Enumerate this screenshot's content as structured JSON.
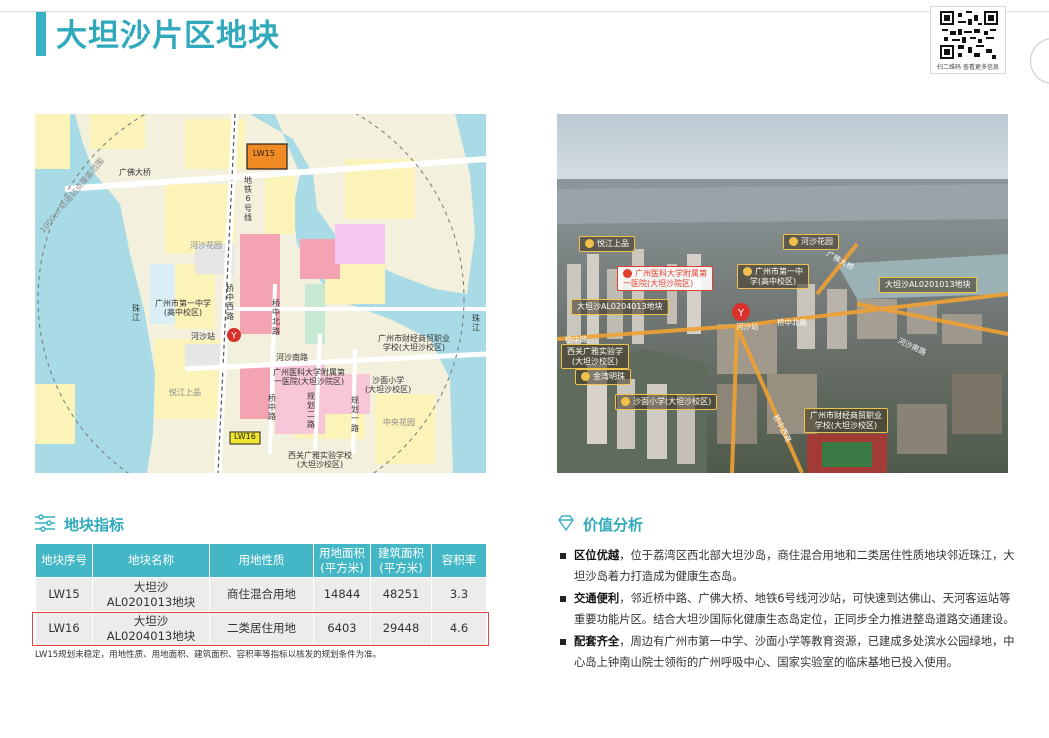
{
  "page": {
    "title": "大坦沙片区地块",
    "qr_caption": "扫二维码 查看更多信息"
  },
  "map": {
    "labels": {
      "radius": "1000m 轨道站点覆盖范围",
      "guangfo_bridge": "广佛大桥",
      "lw15": "LW15",
      "lw16": "LW16",
      "metro_line": "地铁6号线",
      "hesha_garden": "河沙花园",
      "no1_middle": "广州市第一中学\n(高中校区)",
      "pearl_left": "珠江",
      "pearl_right": "珠江",
      "hesha_station": "河沙站",
      "qiaozhongxi": "桥中西路",
      "qiaozhongbei": "桥中北路",
      "finance_school": "广州市财经商贸职业\n学校(大坦沙校区)",
      "hesha_south": "河沙南路",
      "hospital": "广州医科大学附属第\n一医院(大坦沙院区)",
      "shamian_primary": "沙面小学\n(大坦沙校区)",
      "yuejiang": "悦江上品",
      "qiaozhong": "桥中路",
      "guihua2": "规划二路",
      "guihua1": "规划一路",
      "central_park": "中央花园",
      "xiguan_school": "西关广雅实验学校\n(大坦沙校区)"
    }
  },
  "photo": {
    "labels": {
      "yuejiang": "悦江上品",
      "hesha_garden": "河沙花园",
      "hospital": "广州医科大学附属第\n一医院(大坦沙院区)",
      "no1_middle": "广州市第一中\n学(高中校区)",
      "guangfo_bridge": "广佛大桥",
      "lw15": "大坦沙AL0201013地块",
      "lw16": "大坦沙AL0204013地块",
      "hesha_station": "河沙站",
      "qiaozhong": "桥中路",
      "qiaozhongbei": "桥中北路",
      "xiguan_school": "西关广雅实验学\n(大坦沙校区)",
      "jinwan": "金湾明珠",
      "hesha_south": "河沙南路",
      "shamian_primary": "沙面小学(大坦沙校区)",
      "finance_school": "广州市财经商贸职业\n学校(大坦沙校区)",
      "qiaozhongxi": "桥中西路"
    }
  },
  "indicators": {
    "heading": "地块指标",
    "columns": [
      "地块序号",
      "地块名称",
      "用地性质",
      "用地面积\n(平方米)",
      "建筑面积\n(平方米)",
      "容积率"
    ],
    "rows": [
      [
        "LW15",
        "大坦沙\nAL0201013地块",
        "商住混合用地",
        "14844",
        "48251",
        "3.3"
      ],
      [
        "LW16",
        "大坦沙\nAL0204013地块",
        "二类居住用地",
        "6403",
        "29448",
        "4.6"
      ]
    ],
    "footnote": "LW15规划未稳定，用地性质、用地面积、建筑面积、容积率等指标以核发的规划条件为准。"
  },
  "value_analysis": {
    "heading": "价值分析",
    "items": [
      {
        "title": "区位优越",
        "text": "，位于荔湾区西北部大坦沙岛，商住混合用地和二类居住性质地块邻近珠江，大坦沙岛着力打造成为健康生态岛。"
      },
      {
        "title": "交通便利",
        "text": "，邻近桥中路、广佛大桥、地铁6号线河沙站，可快速到达佛山、天河客运站等重要功能片区。结合大坦沙国际化健康生态岛定位，正同步全力推进整岛道路交通建设。"
      },
      {
        "title": "配套齐全",
        "text": "，周边有广州市第一中学、沙面小学等教育资源，已建成多处滨水公园绿地，中心岛上钟南山院士领衔的广州呼吸中心、国家实验室的临床基地已投入使用。"
      }
    ]
  },
  "colors": {
    "accent": "#36b2c4",
    "table_header": "#43b7c6",
    "highlight_border": "#e0463b",
    "tag_gold": "#f0c14b"
  }
}
